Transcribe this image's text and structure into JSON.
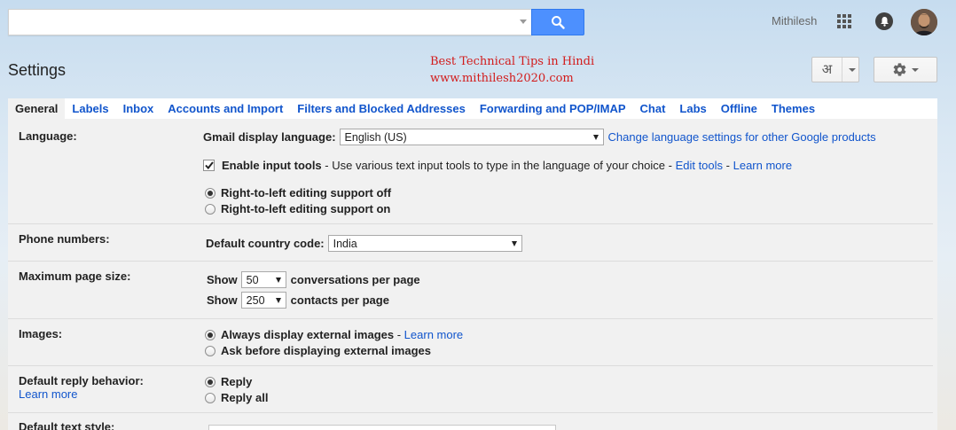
{
  "header": {
    "username": "Mithilesh",
    "page_title": "Settings",
    "promo_line1": "Best Technical Tips in Hindi",
    "promo_line2": "www.mithilesh2020.com",
    "input_tool_glyph": "अ"
  },
  "search": {
    "value": "",
    "placeholder": ""
  },
  "tabs": [
    {
      "label": "General",
      "active": true
    },
    {
      "label": "Labels"
    },
    {
      "label": "Inbox"
    },
    {
      "label": "Accounts and Import"
    },
    {
      "label": "Filters and Blocked Addresses"
    },
    {
      "label": "Forwarding and POP/IMAP"
    },
    {
      "label": "Chat"
    },
    {
      "label": "Labs"
    },
    {
      "label": "Offline"
    },
    {
      "label": "Themes"
    }
  ],
  "language": {
    "label": "Language:",
    "display_label": "Gmail display language:",
    "display_value": "English (US)",
    "change_link": "Change language settings for other Google products",
    "input_tools_label": "Enable input tools",
    "input_tools_desc": " - Use various text input tools to type in the language of your choice - ",
    "edit_tools": "Edit tools",
    "sep": " - ",
    "learn_more": "Learn more",
    "rtl_off": "Right-to-left editing support off",
    "rtl_on": "Right-to-left editing support on"
  },
  "phone": {
    "label": "Phone numbers:",
    "country_label": "Default country code:",
    "country_value": "India"
  },
  "page_size": {
    "label": "Maximum page size:",
    "show": "Show",
    "conversations_value": "50",
    "conversations_suffix": "conversations per page",
    "contacts_value": "250",
    "contacts_suffix": "contacts per page"
  },
  "images": {
    "label": "Images:",
    "always": "Always display external images",
    "sep": " - ",
    "learn_more": "Learn more",
    "ask": "Ask before displaying external images"
  },
  "reply": {
    "label": "Default reply behavior:",
    "learn_more": "Learn more",
    "reply": "Reply",
    "reply_all": "Reply all"
  },
  "text_style": {
    "label": "Default text style:"
  },
  "colors": {
    "accent": "#4d90fe",
    "link": "#1155cc",
    "promo": "#d21b1b"
  }
}
